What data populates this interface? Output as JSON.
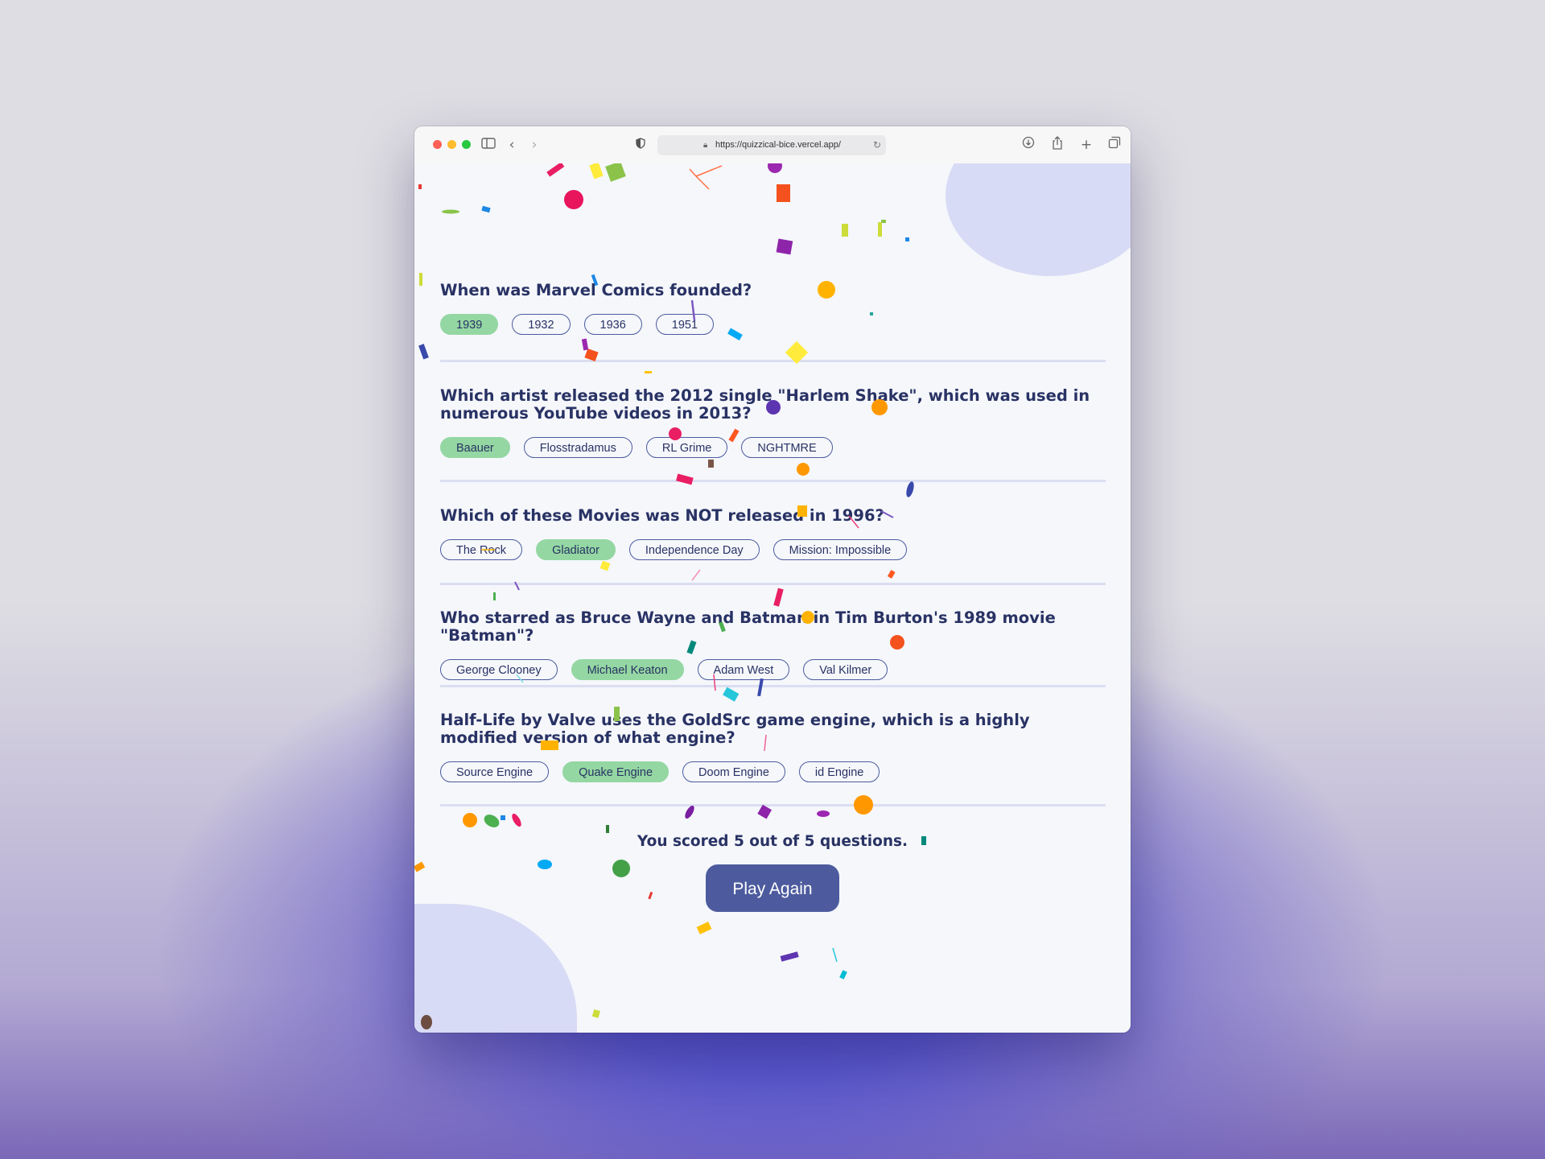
{
  "browser": {
    "url": "https://quizzical-bice.vercel.app/"
  },
  "quiz": {
    "questions": [
      {
        "text": "When was Marvel Comics founded?",
        "answers": [
          "1939",
          "1932",
          "1936",
          "1951"
        ],
        "selected": 0
      },
      {
        "text": "Which artist released the 2012 single \"Harlem Shake\", which was used in numerous YouTube videos in 2013?",
        "answers": [
          "Baauer",
          "Flosstradamus",
          "RL Grime",
          "NGHTMRE"
        ],
        "selected": 0
      },
      {
        "text": "Which of these Movies was NOT released in 1996?",
        "answers": [
          "The Rock",
          "Gladiator",
          "Independence Day",
          "Mission: Impossible"
        ],
        "selected": 1
      },
      {
        "text": "Who starred as Bruce Wayne and Batman in Tim Burton's 1989 movie \"Batman\"?",
        "answers": [
          "George Clooney",
          "Michael Keaton",
          "Adam West",
          "Val Kilmer"
        ],
        "selected": 1
      },
      {
        "text": "Half-Life by Valve uses the GoldSrc game engine, which is a highly modified version of what engine?",
        "answers": [
          "Source Engine",
          "Quake Engine",
          "Doom Engine",
          "id Engine"
        ],
        "selected": 1
      }
    ],
    "score_text": "You scored 5 out of 5 questions.",
    "play_again_label": "Play Again"
  },
  "colors": {
    "selected_answer": "#94d7a2",
    "primary": "#4d5b9e",
    "text": "#293264",
    "blob": "#d8dbf5"
  }
}
